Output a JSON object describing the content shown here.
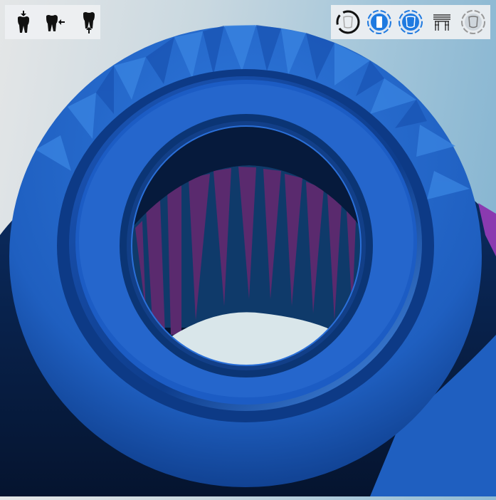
{
  "viewer": {
    "colors": {
      "model": "#2b6fd0",
      "model_dark": "#0a2450",
      "model_highlight": "#3f86e6",
      "inner_wall": "#5a2a6e",
      "accent": "#1f7ae0"
    }
  },
  "toolbar_left": {
    "buttons": [
      {
        "name": "tooth-insertion-direction-icon"
      },
      {
        "name": "tooth-mesial-direction-icon"
      },
      {
        "name": "tooth-occlusal-direction-icon"
      }
    ]
  },
  "toolbar_right": {
    "buttons": [
      {
        "name": "view-rotate-crown-icon"
      },
      {
        "name": "view-front-crown-icon"
      },
      {
        "name": "view-crown-filled-icon"
      },
      {
        "name": "bridge-abutments-icon"
      },
      {
        "name": "view-crown-outline-icon"
      }
    ]
  }
}
